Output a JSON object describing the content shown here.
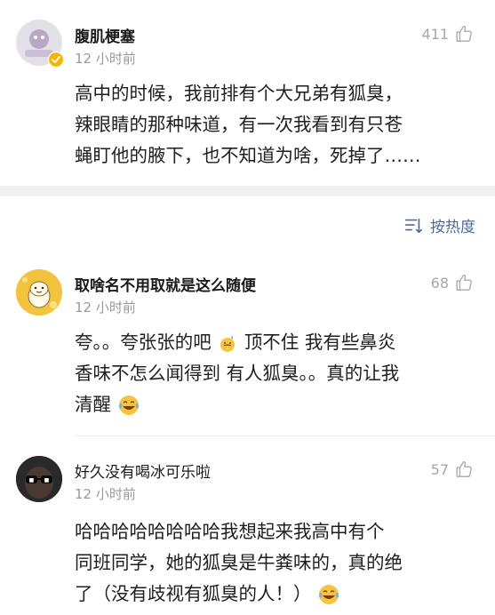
{
  "top_comment": {
    "username": "腹肌梗塞",
    "time": "12 小时前",
    "likes": "411",
    "lines": [
      "高中的时候，我前排有个大兄弟有狐臭，",
      "辣眼睛的那种味道，有一次我看到有只苍",
      "蝇盯他的腋下，也不知道为啥，死掉了……"
    ]
  },
  "sort": {
    "label": "按热度"
  },
  "comments": [
    {
      "username": "取啥名不用取就是这么随便",
      "time": "12 小时前",
      "likes": "68",
      "line1_a": "夸。。夸张张的吧",
      "line1_b": "顶不住 我有些鼻炎",
      "line2": "香味不怎么闻得到 有人狐臭。。真的让我",
      "line3": "清醒"
    },
    {
      "username": "好久没有喝冰可乐啦",
      "time": "12 小时前",
      "likes": "57",
      "line1": "哈哈哈哈哈哈哈哈我想起来我高中有个",
      "line2": "同班同学，她的狐臭是牛粪味的，真的绝",
      "line3": "了（没有歧视有狐臭的人！）"
    }
  ],
  "colors": {
    "accent": "#4d6b9a",
    "verified": "#f5b400",
    "divider": "#f1f1f1"
  }
}
